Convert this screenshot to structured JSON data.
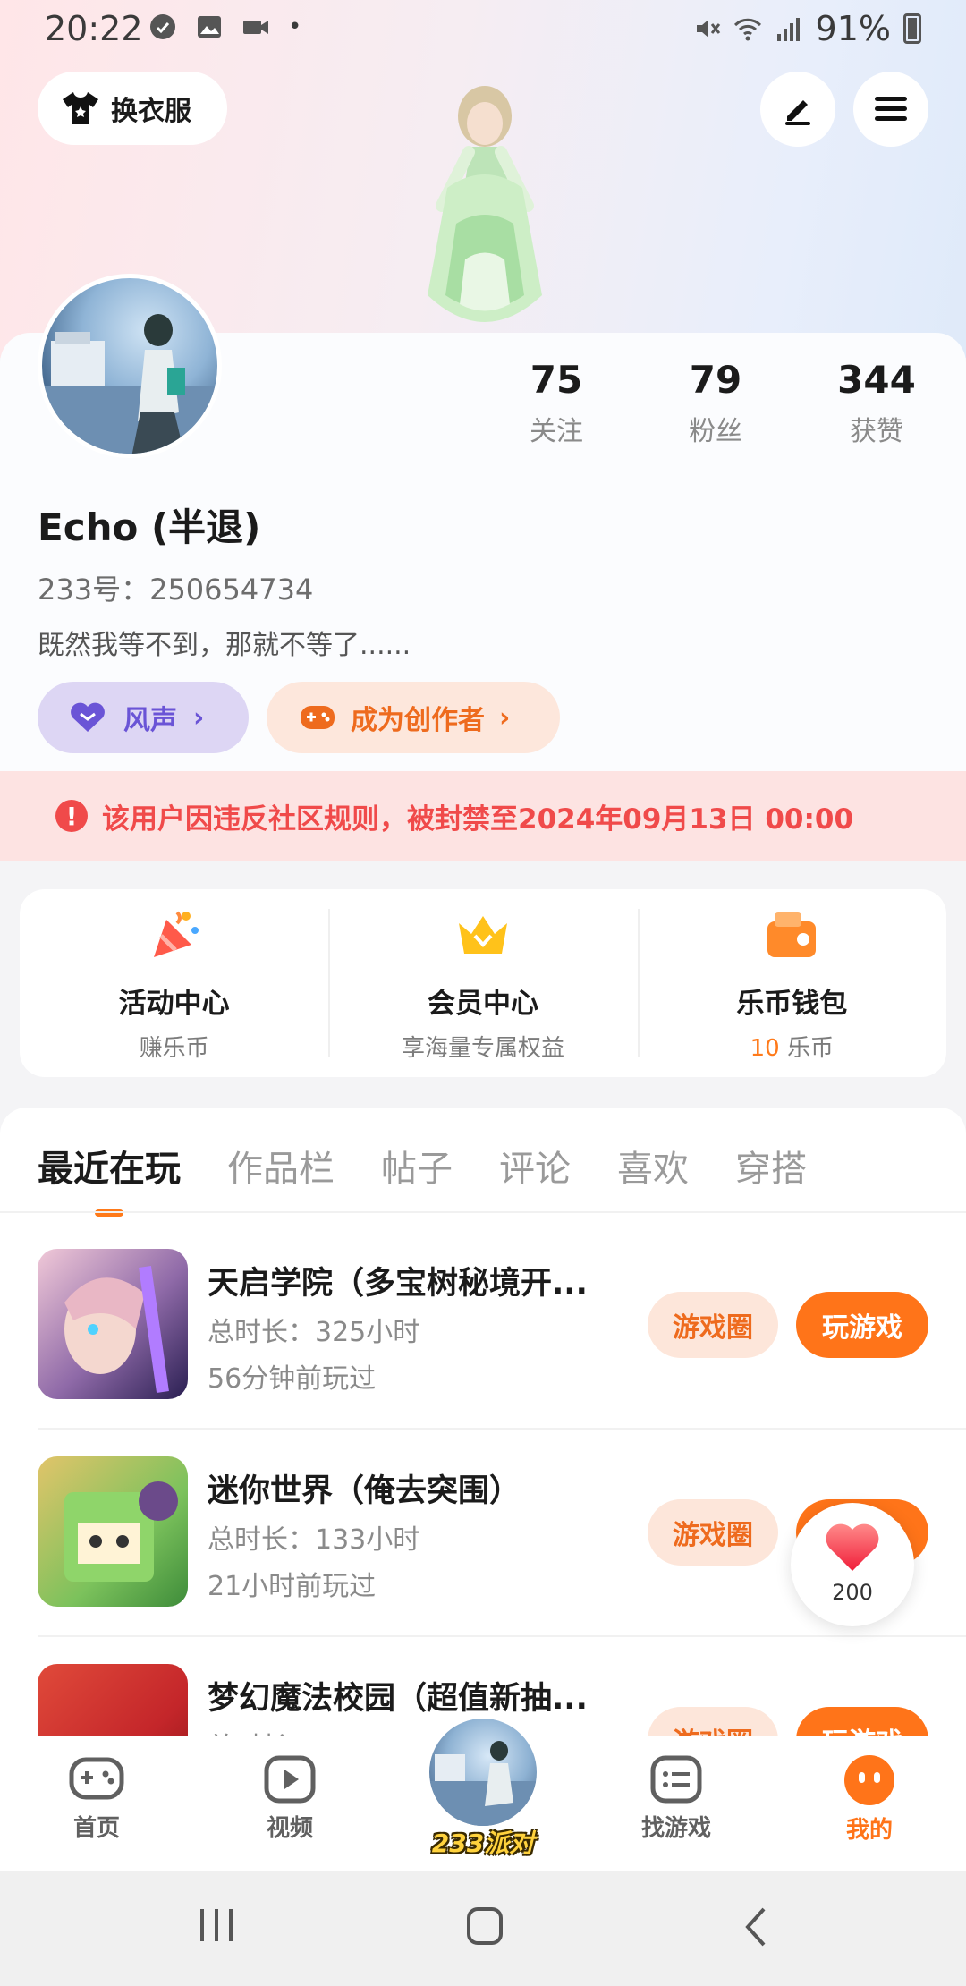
{
  "status_bar": {
    "time": "20:22",
    "battery": "91%"
  },
  "header": {
    "outfit_label": "换衣服"
  },
  "profile": {
    "username": "Echo (半退)",
    "id_text": "233号：250654734",
    "bio": "既然我等不到，那就不等了......",
    "stats": [
      {
        "value": "75",
        "label": "关注"
      },
      {
        "value": "79",
        "label": "粉丝"
      },
      {
        "value": "344",
        "label": "获赞"
      }
    ],
    "pill_wind": "风声",
    "pill_creator": "成为创作者"
  },
  "ban_notice": "该用户因违反社区规则，被封禁至2024年09月13日 00:00",
  "features": [
    {
      "title": "活动中心",
      "subtitle": "赚乐币"
    },
    {
      "title": "会员中心",
      "subtitle": "享海量专属权益"
    },
    {
      "title": "乐币钱包",
      "coin_count": "10",
      "subtitle": "乐币"
    }
  ],
  "tabs": [
    "最近在玩",
    "作品栏",
    "帖子",
    "评论",
    "喜欢",
    "穿搭"
  ],
  "games": [
    {
      "title": "天启学院（多宝树秘境开...",
      "duration": "总时长：325小时",
      "last_played": "56分钟前玩过",
      "circle_label": "游戏圈",
      "play_label": "玩游戏"
    },
    {
      "title": "迷你世界（俺去突围）",
      "duration": "总时长：133小时",
      "last_played": "21小时前玩过",
      "circle_label": "游戏圈",
      "play_label": "玩游戏"
    },
    {
      "title": "梦幻魔法校园（超值新抽...",
      "duration": "总时长：",
      "last_played": "",
      "circle_label": "游戏圈",
      "play_label": "玩游戏"
    }
  ],
  "like_float": {
    "count": "200"
  },
  "bottom_nav": {
    "home": "首页",
    "video": "视频",
    "center": "233派对",
    "find_game": "找游戏",
    "mine": "我的"
  },
  "colors": {
    "accent": "#ff7419",
    "ban": "#f04a4a",
    "purple": "#6a54d6"
  }
}
